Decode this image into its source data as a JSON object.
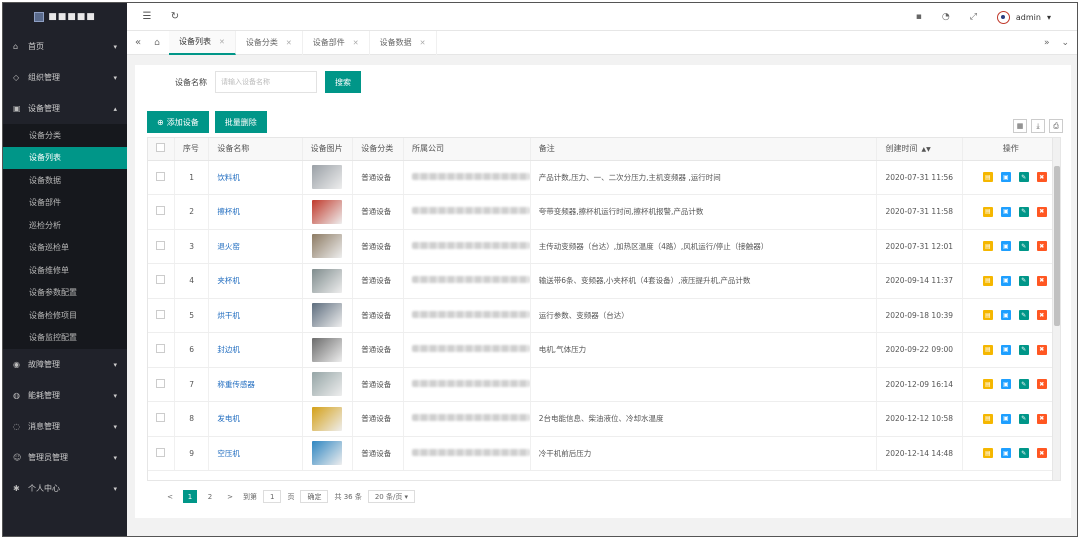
{
  "brand": {
    "logo_text": "■■■■■"
  },
  "sidebar": {
    "items": [
      {
        "label": "首页",
        "icon": "home-icon",
        "arrow": "▾"
      },
      {
        "label": "组织管理",
        "icon": "tag-icon",
        "arrow": "▾"
      },
      {
        "label": "设备管理",
        "icon": "device-icon",
        "arrow": "▴"
      }
    ],
    "sub_items": [
      "设备分类",
      "设备列表",
      "设备数据",
      "设备部件",
      "巡检分析",
      "设备巡检单",
      "设备维修单",
      "设备参数配置",
      "设备检修项目",
      "设备监控配置"
    ],
    "active_sub": 1,
    "items_after": [
      {
        "label": "故障管理",
        "icon": "shield-icon",
        "arrow": "▾"
      },
      {
        "label": "能耗管理",
        "icon": "gauge-icon",
        "arrow": "▾"
      },
      {
        "label": "消息管理",
        "icon": "bell-icon",
        "arrow": "▾"
      },
      {
        "label": "管理员管理",
        "icon": "users-icon",
        "arrow": "▾"
      },
      {
        "label": "个人中心",
        "icon": "gear-icon",
        "arrow": "▾"
      }
    ]
  },
  "topbar": {
    "user": "admin"
  },
  "tabs": [
    {
      "label": "设备列表",
      "active": true
    },
    {
      "label": "设备分类",
      "active": false
    },
    {
      "label": "设备部件",
      "active": false
    },
    {
      "label": "设备数据",
      "active": false
    }
  ],
  "search": {
    "label": "设备名称",
    "placeholder": "请输入设备名称",
    "button": "搜索"
  },
  "toolbar": {
    "add": "添加设备",
    "batch_delete": "批量删除"
  },
  "table": {
    "headers": [
      "序号",
      "设备名称",
      "设备图片",
      "设备分类",
      "所属公司",
      "备注",
      "创建时间",
      "操作"
    ],
    "rows": [
      {
        "no": "1",
        "name": "饮料机",
        "category": "普通设备",
        "note": "产品计数,压力、一、二次分压力,主机变频器 ,运行时间",
        "time": "2020-07-31 11:56",
        "img_color": "#9aa0a6"
      },
      {
        "no": "2",
        "name": "擦杯机",
        "category": "普通设备",
        "note": "夸带变频器,擦杯机运行时间,擦杯机报警,产品计数",
        "time": "2020-07-31 11:58",
        "img_color": "#c0392b"
      },
      {
        "no": "3",
        "name": "退火窑",
        "category": "普通设备",
        "note": "主传动变频器（台达）,加热区温度（4路）,风机运行/停止（接触器）",
        "time": "2020-07-31 12:01",
        "img_color": "#8d7b63"
      },
      {
        "no": "4",
        "name": "夹杯机",
        "category": "普通设备",
        "note": "输送带6条、变频器,小夹杯机（4套设备）,液压提升机,产品计数",
        "time": "2020-09-14 11:37",
        "img_color": "#7f8c8d"
      },
      {
        "no": "5",
        "name": "烘干机",
        "category": "普通设备",
        "note": "运行参数、变频器（台达）",
        "time": "2020-09-18 10:39",
        "img_color": "#5d6d7e"
      },
      {
        "no": "6",
        "name": "封边机",
        "category": "普通设备",
        "note": "电机,气体压力",
        "time": "2020-09-22 09:00",
        "img_color": "#6b6b6b"
      },
      {
        "no": "7",
        "name": "称重传感器",
        "category": "普通设备",
        "note": "",
        "time": "2020-12-09 16:14",
        "img_color": "#95a5a6"
      },
      {
        "no": "8",
        "name": "发电机",
        "category": "普通设备",
        "note": "2台电能信息、柴油液位、冷却水温度",
        "time": "2020-12-12 10:58",
        "img_color": "#d4a017"
      },
      {
        "no": "9",
        "name": "空压机",
        "category": "普通设备",
        "note": "冷干机前后压力",
        "time": "2020-12-14 14:48",
        "img_color": "#2e86c1"
      }
    ]
  },
  "pager": {
    "prev": "<",
    "pages": [
      "1",
      "2"
    ],
    "next": ">",
    "goto_label": "到第",
    "goto_value": "1",
    "page_unit": "页",
    "confirm": "确定",
    "total": "共 36 条",
    "per_page": "20 条/页"
  }
}
